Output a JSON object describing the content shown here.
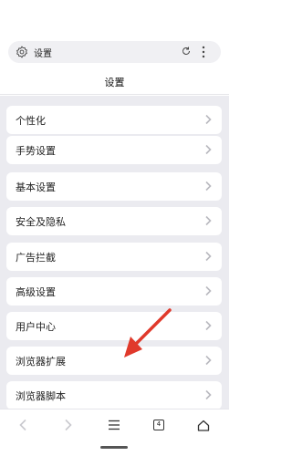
{
  "address_bar": {
    "text": "设置",
    "left_icon": "gear-icon",
    "reload_icon": "refresh-icon",
    "menu_icon": "more-vertical-icon"
  },
  "page": {
    "title": "设置"
  },
  "settings": {
    "items": [
      {
        "label": "个性化"
      },
      {
        "label": "手势设置"
      },
      {
        "label": "基本设置"
      },
      {
        "label": "安全及隐私"
      },
      {
        "label": "广告拦截"
      },
      {
        "label": "高级设置"
      },
      {
        "label": "用户中心"
      },
      {
        "label": "浏览器扩展"
      },
      {
        "label": "浏览器脚本"
      }
    ]
  },
  "annotation": {
    "color": "#e0392b",
    "icon": "arrow-icon"
  },
  "toolbar": {
    "tab_count": "4",
    "icons": [
      "back-icon",
      "forward-icon",
      "menu-icon",
      "tabs-icon",
      "home-icon"
    ]
  },
  "colors": {
    "list_background": "#ebebf0",
    "chevron": "#b9b9bf"
  }
}
